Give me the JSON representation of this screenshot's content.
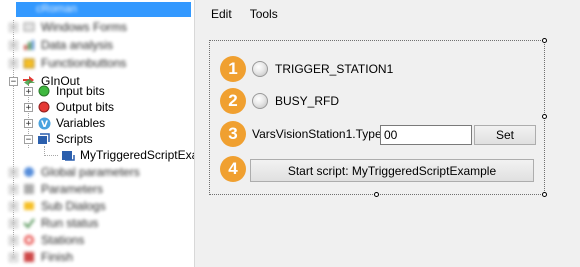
{
  "tree": {
    "selected_label": "cRoman",
    "items": [
      {
        "label": "Windows Forms",
        "blurred": true
      },
      {
        "label": "Data analysis",
        "blurred": true
      },
      {
        "label": "Functionbuttons",
        "blurred": true
      },
      {
        "label": "GInOut",
        "blurred": false
      },
      {
        "label": "Input bits",
        "blurred": false
      },
      {
        "label": "Output bits",
        "blurred": false
      },
      {
        "label": "Variables",
        "blurred": false
      },
      {
        "label": "Scripts",
        "blurred": false
      },
      {
        "label": "MyTriggeredScriptExa",
        "blurred": false
      },
      {
        "label": "Global parameters",
        "blurred": true
      },
      {
        "label": "Parameters",
        "blurred": true
      },
      {
        "label": "Sub Dialogs",
        "blurred": true
      },
      {
        "label": "Run status",
        "blurred": true
      },
      {
        "label": "Stations",
        "blurred": true
      },
      {
        "label": "Finish",
        "blurred": true
      }
    ],
    "expand_plus": "+",
    "expand_minus": "−"
  },
  "menu": {
    "edit": "Edit",
    "tools": "Tools"
  },
  "form": {
    "badges": [
      "1",
      "2",
      "3",
      "4"
    ],
    "trigger_label": "TRIGGER_STATION1",
    "busy_label": "BUSY_RFD",
    "var_label": "VarsVisionStation1.Type:",
    "var_value": "00",
    "set_button": "Set",
    "start_button": "Start script: MyTriggeredScriptExample"
  },
  "colors": {
    "badge": "#f0a030",
    "selection": "#3399ff"
  }
}
